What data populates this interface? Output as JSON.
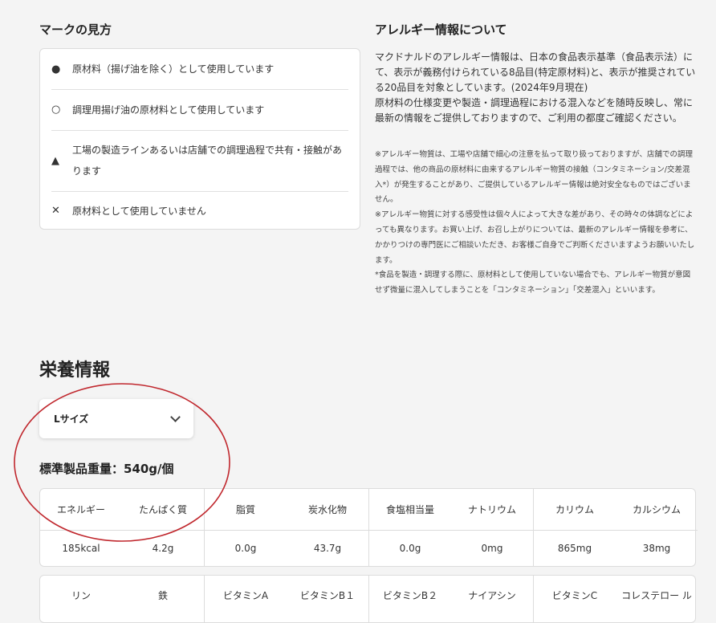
{
  "marks": {
    "title": "マークの見方",
    "items": [
      {
        "icon": "filled-circle-icon",
        "symbol": "●",
        "label": "原材料（揚げ油を除く）として使用しています"
      },
      {
        "icon": "open-circle-icon",
        "symbol": "○",
        "label": "調理用揚げ油の原材料として使用しています"
      },
      {
        "icon": "triangle-icon",
        "symbol": "▲",
        "label": "工場の製造ラインあるいは店舗での調理過程で共有・接触があります"
      },
      {
        "icon": "cross-icon",
        "symbol": "✕",
        "label": "原材料として使用していません"
      }
    ]
  },
  "allergy": {
    "title": "アレルギー情報について",
    "body1": "マクドナルドのアレルギー情報は、日本の食品表示基準（食品表示法）にて、表示が義務付けられている8品目(特定原材料)と、表示が推奨されている20品目を対象としています。(2024年9月現在)",
    "body2": "原材料の仕様変更や製造・調理過程における混入などを随時反映し、常に最新の情報をご提供しておりますので、ご利用の都度ご確認ください。",
    "note1": "※アレルギー物質は、工場や店舗で細心の注意を払って取り扱っておりますが、店舗での調理過程では、他の商品の原材料に由来するアレルギー物質の接触（コンタミネーション/交差混入*）が発生することがあり、ご提供しているアレルギー情報は絶対安全なものではございません。",
    "note2": "※アレルギー物質に対する感受性は個々人によって大きな差があり、その時々の体調などによっても異なります。お買い上げ、お召し上がりについては、最新のアレルギー情報を参考に、かかりつけの専門医にご相談いただき、お客様ご自身でご判断くださいますようお願いいたします。",
    "note3": "*食品を製造・調理する際に、原材料として使用していない場合でも、アレルギー物質が意図せず微量に混入してしまうことを「コンタミネーション」「交差混入」といいます。"
  },
  "nutrition": {
    "title": "栄養情報",
    "size_select": "Lサイズ",
    "weight_label": "標準製品重量：540g/個",
    "table1": {
      "headers": [
        "エネルギー",
        "たんぱく質",
        "脂質",
        "炭水化物",
        "食塩相当量",
        "ナトリウム",
        "カリウム",
        "カルシウム"
      ],
      "values": [
        "185kcal",
        "4.2g",
        "0.0g",
        "43.7g",
        "0.0g",
        "0mg",
        "865mg",
        "38mg"
      ]
    },
    "table2": {
      "headers": [
        "リン",
        "鉄",
        "ビタミンA",
        "ビタミンB１",
        "ビタミンB２",
        "ナイアシン",
        "ビタミンC",
        "コレステロー ル"
      ]
    }
  },
  "colors": {
    "background": "#f4f4f4",
    "annotation": "#c0272d"
  }
}
